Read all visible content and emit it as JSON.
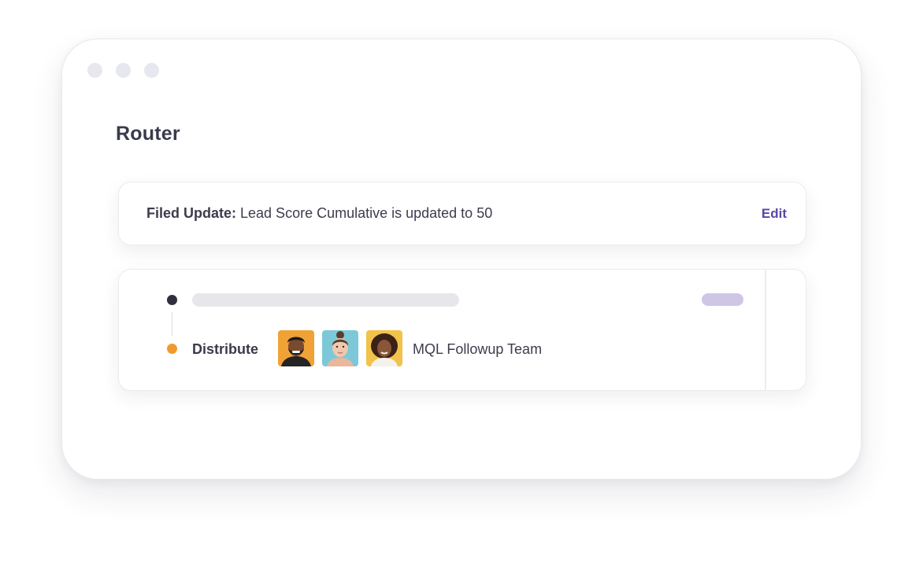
{
  "window": {
    "title": "Router"
  },
  "update_card": {
    "label": "Filed Update:",
    "text": " Lead Score Cumulative is updated to 50",
    "edit_label": "Edit"
  },
  "route_card": {
    "step_label": "Distribute",
    "team_name": "MQL Followup Team",
    "avatars": [
      {
        "name": "avatar-man-beard",
        "bg": "#f0a236"
      },
      {
        "name": "avatar-woman-bun",
        "bg": "#7cc8d8"
      },
      {
        "name": "avatar-woman-curly",
        "bg": "#f2c24a"
      }
    ]
  },
  "colors": {
    "accent": "#5b46a8",
    "node_start": "#2f2f3d",
    "node_distribute": "#f09a2e",
    "skeleton": "#e7e7eb",
    "skeleton_pill": "#cfc6e6"
  }
}
